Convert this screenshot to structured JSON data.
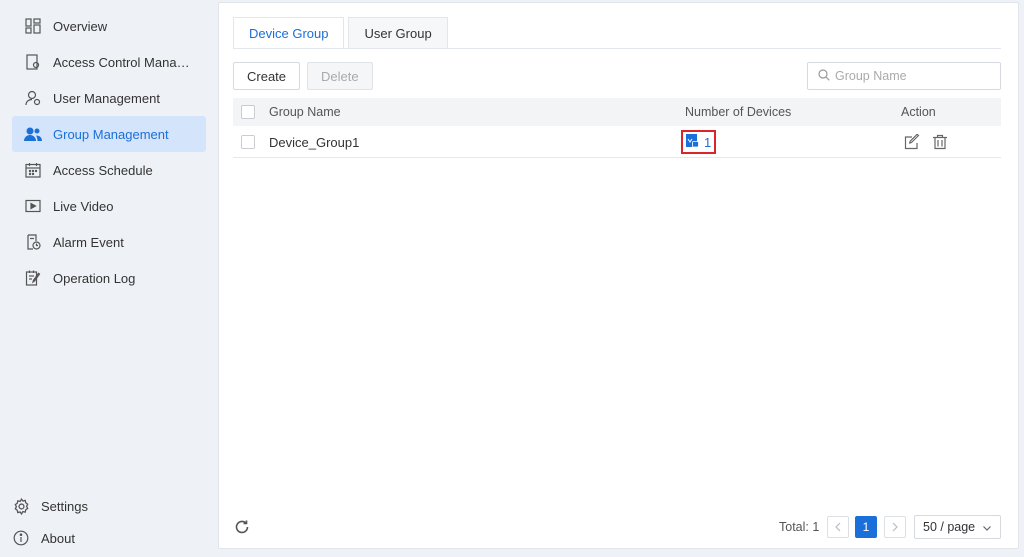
{
  "sidebar": {
    "items": [
      {
        "label": "Overview",
        "icon": "overview-icon",
        "active": false
      },
      {
        "label": "Access Control Manag...",
        "icon": "access-control-icon",
        "active": false
      },
      {
        "label": "User Management",
        "icon": "user-icon",
        "active": false
      },
      {
        "label": "Group Management",
        "icon": "group-icon",
        "active": true
      },
      {
        "label": "Access Schedule",
        "icon": "calendar-icon",
        "active": false
      },
      {
        "label": "Live Video",
        "icon": "video-icon",
        "active": false
      },
      {
        "label": "Alarm Event",
        "icon": "alarm-icon",
        "active": false
      },
      {
        "label": "Operation Log",
        "icon": "log-icon",
        "active": false
      }
    ],
    "bottom": [
      {
        "label": "Settings",
        "icon": "gear-icon"
      },
      {
        "label": "About",
        "icon": "info-icon"
      }
    ]
  },
  "tabs": [
    {
      "label": "Device Group",
      "active": true
    },
    {
      "label": "User Group",
      "active": false
    }
  ],
  "toolbar": {
    "create_label": "Create",
    "delete_label": "Delete"
  },
  "search": {
    "placeholder": "Group Name",
    "value": ""
  },
  "table": {
    "headers": {
      "group_name": "Group Name",
      "devices": "Number of Devices",
      "action": "Action"
    },
    "rows": [
      {
        "group_name": "Device_Group1",
        "devices": "1"
      }
    ]
  },
  "footer": {
    "total": "Total: 1",
    "current_page": "1",
    "per_page": "50 / page"
  },
  "colors": {
    "accent": "#1b6fd8",
    "highlight_box": "#d9262b",
    "active_nav_bg": "#d4e4fb"
  }
}
